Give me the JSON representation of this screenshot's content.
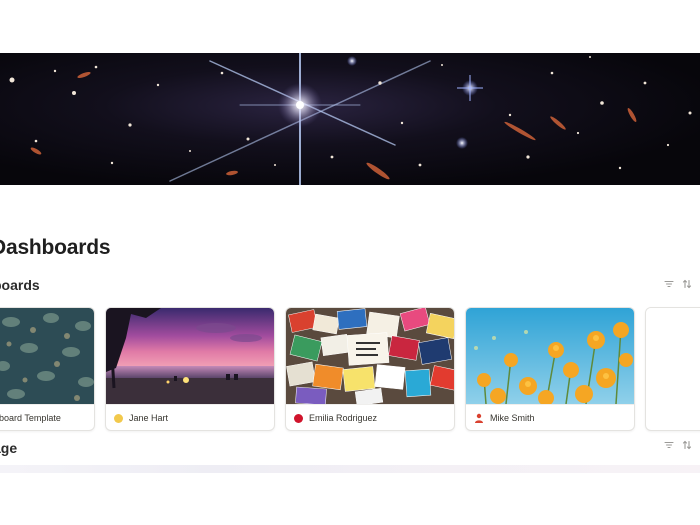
{
  "page": {
    "title": "Dashboards"
  },
  "sections": [
    {
      "title": "Dashboards",
      "display_title": "boards"
    },
    {
      "title": "Usage",
      "display_title": "age"
    }
  ],
  "icons": {
    "filter": "filter-icon",
    "sort": "sort-icon",
    "person": "person-icon"
  },
  "cards": [
    {
      "label": "board Template",
      "thumb": "pattern-wallpaper"
    },
    {
      "label": "Jane Hart",
      "marker": "dot",
      "marker_color": "#f2c94c",
      "thumb": "beach-sunset"
    },
    {
      "label": "Emilia Rodriguez",
      "marker": "dot",
      "marker_color": "#d0142c",
      "thumb": "book-pile"
    },
    {
      "label": "Mike Smith",
      "marker": "person-icon",
      "marker_color": "#d9412f",
      "thumb": "orange-poppies"
    },
    {
      "label": "",
      "thumb": "blank"
    }
  ]
}
